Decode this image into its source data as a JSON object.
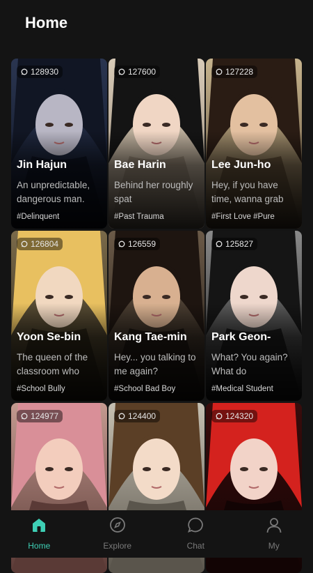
{
  "header": {
    "title": "Home"
  },
  "cards": [
    {
      "count": "128930",
      "name": "Jin Hajun",
      "desc": "An unpredictable, dangerous man.",
      "tag": "#Delinquent",
      "bg1": "#2a3550",
      "bg2": "#0d1220",
      "hair": "#111624",
      "skin": "#b8b6c4"
    },
    {
      "count": "127600",
      "name": "Bae Harin",
      "desc": "Behind her roughly spat",
      "tag": "#Past Trauma",
      "bg1": "#d8cbb8",
      "bg2": "#8f8170",
      "hair": "#141414",
      "skin": "#f0d6c4"
    },
    {
      "count": "127228",
      "name": "Lee Jun-ho",
      "desc": "Hey, if you have time, wanna grab",
      "tag": "#First Love #Pure",
      "bg1": "#c7b48e",
      "bg2": "#5b4a34",
      "hair": "#2a1c14",
      "skin": "#e3c0a0"
    },
    {
      "count": "126804",
      "name": "Yoon Se-bin",
      "desc": "The queen of the classroom who",
      "tag": "#School Bully",
      "bg1": "#7a6a4a",
      "bg2": "#2a2416",
      "hair": "#e8c060",
      "skin": "#f1d8c0"
    },
    {
      "count": "126559",
      "name": "Kang Tae-min",
      "desc": "Hey... you talking to me again?",
      "tag": "#School Bad Boy",
      "bg1": "#6b5a48",
      "bg2": "#1e1712",
      "hair": "#1e1510",
      "skin": "#d8b090"
    },
    {
      "count": "125827",
      "name": "Park Geon-",
      "desc": "What? You again? What do",
      "tag": "#Medical Student",
      "bg1": "#8a8a8a",
      "bg2": "#1a1a1a",
      "hair": "#151515",
      "skin": "#eed7cc"
    },
    {
      "count": "124977",
      "name": "",
      "desc": "",
      "tag": "",
      "bg1": "#c49a90",
      "bg2": "#5a3a36",
      "hair": "#d98f98",
      "skin": "#f3cdbd"
    },
    {
      "count": "124400",
      "name": "",
      "desc": "",
      "tag": "",
      "bg1": "#c6c0b2",
      "bg2": "#5a554c",
      "hair": "#5b3f26",
      "skin": "#f3dbc8"
    },
    {
      "count": "124320",
      "name": "",
      "desc": "",
      "tag": "",
      "bg1": "#3a0c0c",
      "bg2": "#120404",
      "hair": "#d4221e",
      "skin": "#f2d3c8"
    }
  ],
  "nav": [
    {
      "label": "Home",
      "icon": "home-icon"
    },
    {
      "label": "Explore",
      "icon": "compass-icon"
    },
    {
      "label": "Chat",
      "icon": "chat-bubble-icon"
    },
    {
      "label": "My",
      "icon": "user-icon"
    }
  ],
  "colors": {
    "accent": "#3ecfb5",
    "inactive": "#7a7a7a",
    "background": "#141414"
  }
}
